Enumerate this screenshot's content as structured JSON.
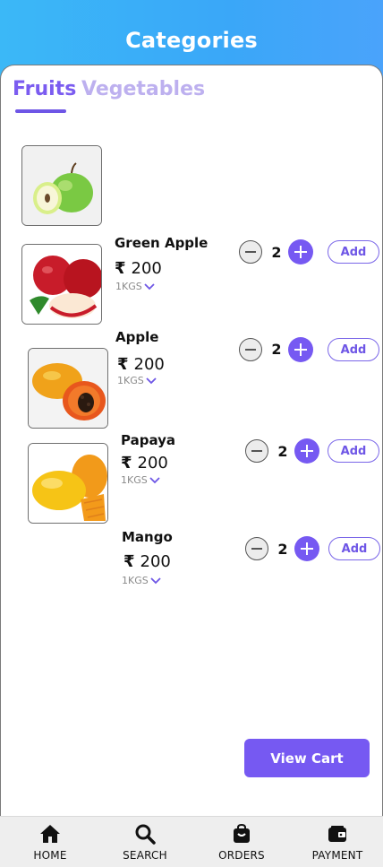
{
  "header": {
    "title": "Categories"
  },
  "tabs": [
    {
      "label": "Fruits",
      "active": true
    },
    {
      "label": "Vegetables",
      "active": false
    }
  ],
  "currency_symbol": "₹",
  "products": [
    {
      "name": "Green Apple",
      "price": "200",
      "unit": "1KGS",
      "quantity": "2",
      "add_label": "Add",
      "image": "green-apple"
    },
    {
      "name": "Apple",
      "price": "200",
      "unit": "1KGS",
      "quantity": "2",
      "add_label": "Add",
      "image": "red-apple"
    },
    {
      "name": "Papaya",
      "price": "200",
      "unit": "1KGS",
      "quantity": "2",
      "add_label": "Add",
      "image": "papaya"
    },
    {
      "name": "Mango",
      "price": "200",
      "unit": "1KGS",
      "quantity": "2",
      "add_label": "Add",
      "image": "mango"
    }
  ],
  "view_cart_label": "View Cart",
  "nav": [
    {
      "label": "HOME",
      "icon": "home-icon"
    },
    {
      "label": "SEARCH",
      "icon": "search-icon"
    },
    {
      "label": "ORDERS",
      "icon": "bag-icon"
    },
    {
      "label": "PAYMENT",
      "icon": "wallet-icon"
    }
  ],
  "colors": {
    "accent": "#7659f2",
    "tab_inactive": "#bdb0ef",
    "header_gradient_start": "#3bb8f7"
  }
}
